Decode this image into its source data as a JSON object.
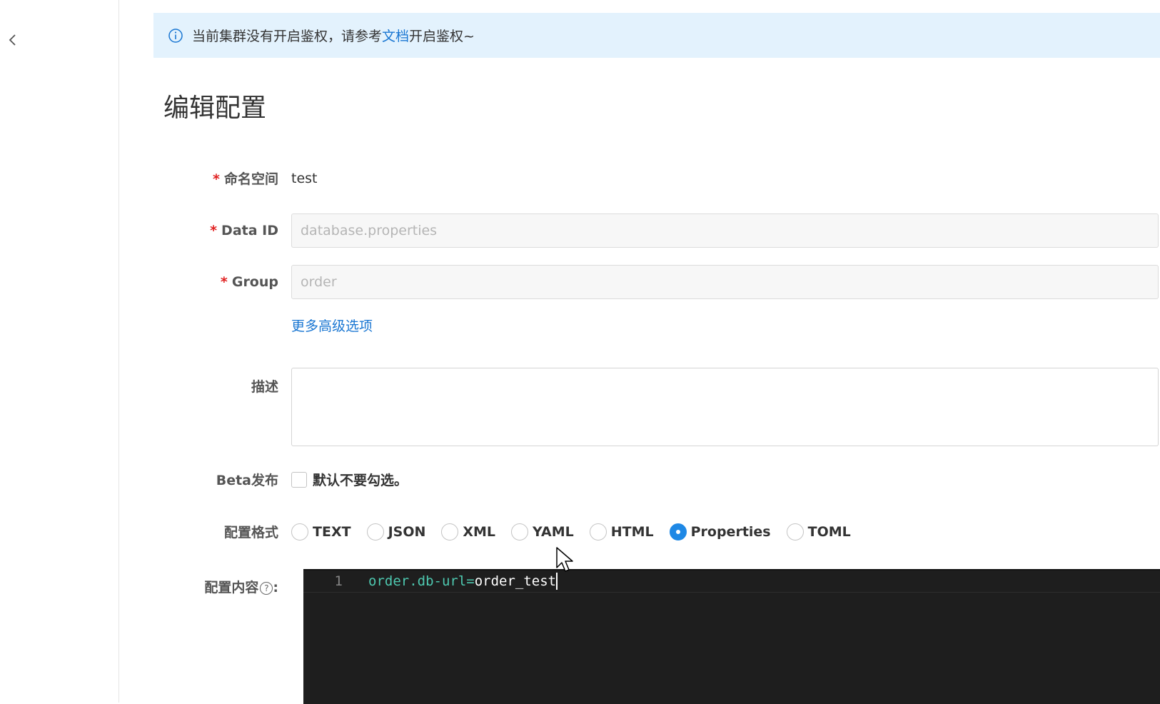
{
  "alert": {
    "text_before": "当前集群没有开启鉴权，请参考",
    "link": "文档",
    "text_after": "开启鉴权~"
  },
  "page": {
    "title": "编辑配置"
  },
  "form": {
    "namespace": {
      "label": "命名空间",
      "value": "test"
    },
    "data_id": {
      "label": "Data ID",
      "value": "database.properties"
    },
    "group": {
      "label": "Group",
      "value": "order"
    },
    "advanced_link": "更多高级选项",
    "description": {
      "label": "描述",
      "value": ""
    },
    "beta": {
      "label": "Beta发布",
      "checkbox_label": "默认不要勾选。",
      "checked": false
    },
    "format": {
      "label": "配置格式",
      "options": [
        "TEXT",
        "JSON",
        "XML",
        "YAML",
        "HTML",
        "Properties",
        "TOML"
      ],
      "selected": "Properties"
    },
    "content": {
      "label": "配置内容",
      "colon": ":",
      "help_glyph": "?",
      "lines": [
        {
          "number": "1",
          "key": "order.db-url=",
          "value": "order_test"
        }
      ]
    }
  },
  "colors": {
    "accent": "#1e88e5",
    "alert_bg": "#e3f2fd",
    "link": "#1976d2",
    "editor_bg": "#1e1e1e"
  }
}
